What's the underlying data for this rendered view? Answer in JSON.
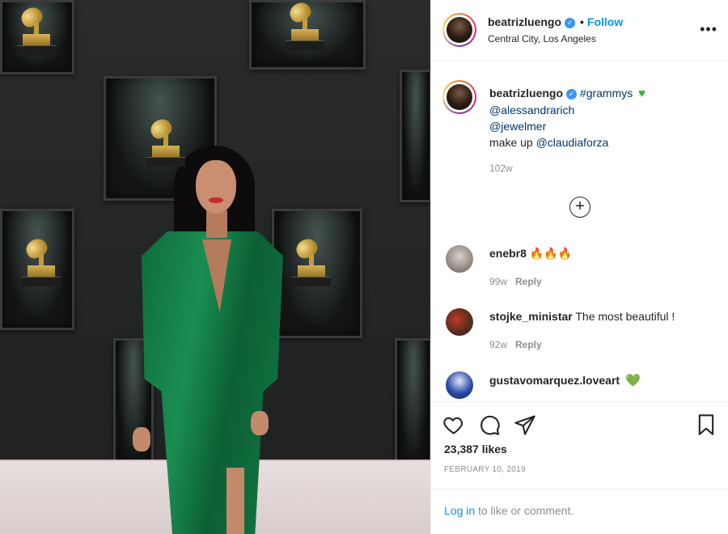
{
  "post": {
    "username": "beatrizluengo",
    "follow_label": "Follow",
    "dot": "•",
    "location": "Central City, Los Angeles",
    "more_label": "•••"
  },
  "caption": {
    "username": "beatrizluengo",
    "hashtag": "#grammys",
    "mention_1": "@alessandrarich",
    "mention_2": "@jewelmer",
    "makeup_prefix": "make up",
    "mention_3": "@claudiaforza",
    "time": "102w"
  },
  "load_more_label": "+",
  "comments": [
    {
      "username": "enebr8",
      "text": "🔥🔥🔥",
      "time": "99w",
      "reply_label": "Reply"
    },
    {
      "username": "stojke_ministar",
      "text": "The most beautiful !",
      "time": "92w",
      "reply_label": "Reply"
    },
    {
      "username": "gustavomarquez.loveart",
      "text": "💚"
    }
  ],
  "likes": "23,387 likes",
  "date": "FEBRUARY 10, 2019",
  "login": {
    "link": "Log in",
    "rest": " to like or comment."
  },
  "colors": {
    "accent": "#0095f6",
    "link": "#00376b",
    "muted": "#8e8e8e",
    "heart_green": "#2fb62f"
  },
  "icons": [
    "verified-badge-icon",
    "more-options-icon",
    "green-heart-icon",
    "load-more-plus-icon",
    "like-heart-icon",
    "comment-icon",
    "share-icon",
    "save-bookmark-icon"
  ]
}
